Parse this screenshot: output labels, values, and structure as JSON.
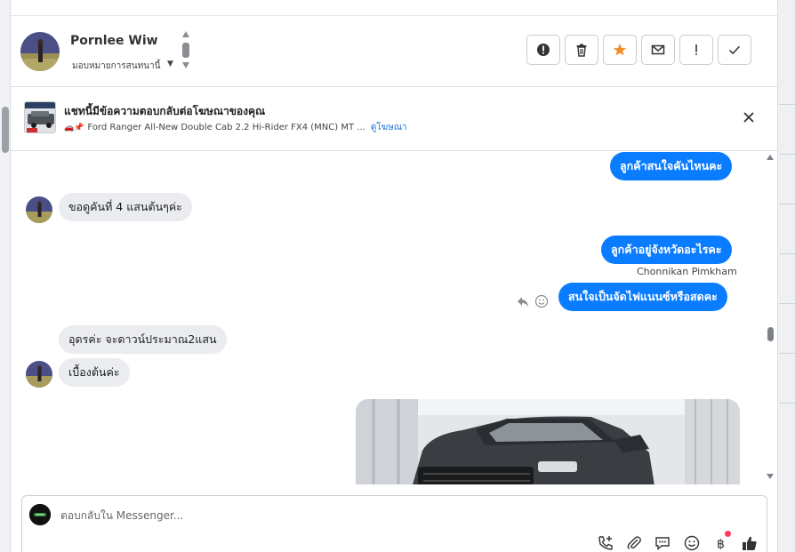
{
  "header": {
    "contact_name": "Pornlee Wiw",
    "assign_label": "มอบหมายการสนทนานี้",
    "actions": [
      {
        "name": "report-spam",
        "icon": "exclamation-circle-icon"
      },
      {
        "name": "delete",
        "icon": "trash-icon"
      },
      {
        "name": "star",
        "icon": "star-icon",
        "color": "#f28c28"
      },
      {
        "name": "mark-unread",
        "icon": "envelope-icon"
      },
      {
        "name": "follow-up",
        "icon": "exclamation-icon"
      },
      {
        "name": "mark-done",
        "icon": "check-icon"
      }
    ]
  },
  "ad_banner": {
    "title": "แชทนี้มีข้อความตอบกลับต่อโฆษณาของคุณ",
    "ad_text": "Ford Ranger All-New Double Cab 2.2 Hi-Rider FX4 (MNC) MT ...",
    "view_ad_link": "ดูโฆษณา"
  },
  "messages": [
    {
      "direction": "out",
      "text": "ลูกค้าสนใจคันไหนคะ"
    },
    {
      "direction": "in",
      "text": "ขอดูคันที่  4 แสนต้นๆค่ะ"
    },
    {
      "direction": "out",
      "text": "ลูกค้าอยู่จังหวัดอะไรคะ",
      "sender": "Chonnikan Pimkham"
    },
    {
      "direction": "out",
      "text": "สนใจเป็นจัดไฟแนนซ์หรือสดคะ"
    },
    {
      "direction": "in",
      "text": "อุดรค่ะ  จะดาวน์ประมาณ2แสน"
    },
    {
      "direction": "in",
      "text": "เบื้องต้นค่ะ"
    },
    {
      "direction": "out",
      "type": "photo",
      "subject": "dark grey pickup truck"
    }
  ],
  "composer": {
    "placeholder": "ตอบกลับใน Messenger...",
    "tools": [
      "phone-plus-icon",
      "paperclip-icon",
      "chat-bubble-icon",
      "smiley-icon",
      "baht-icon",
      "thumbs-up-icon"
    ]
  },
  "colors": {
    "outgoing_bubble": "#0a7cff",
    "incoming_bubble": "#ebecef",
    "star": "#f28c28",
    "link": "#1a6fd6",
    "notification": "#ff3b5c"
  }
}
